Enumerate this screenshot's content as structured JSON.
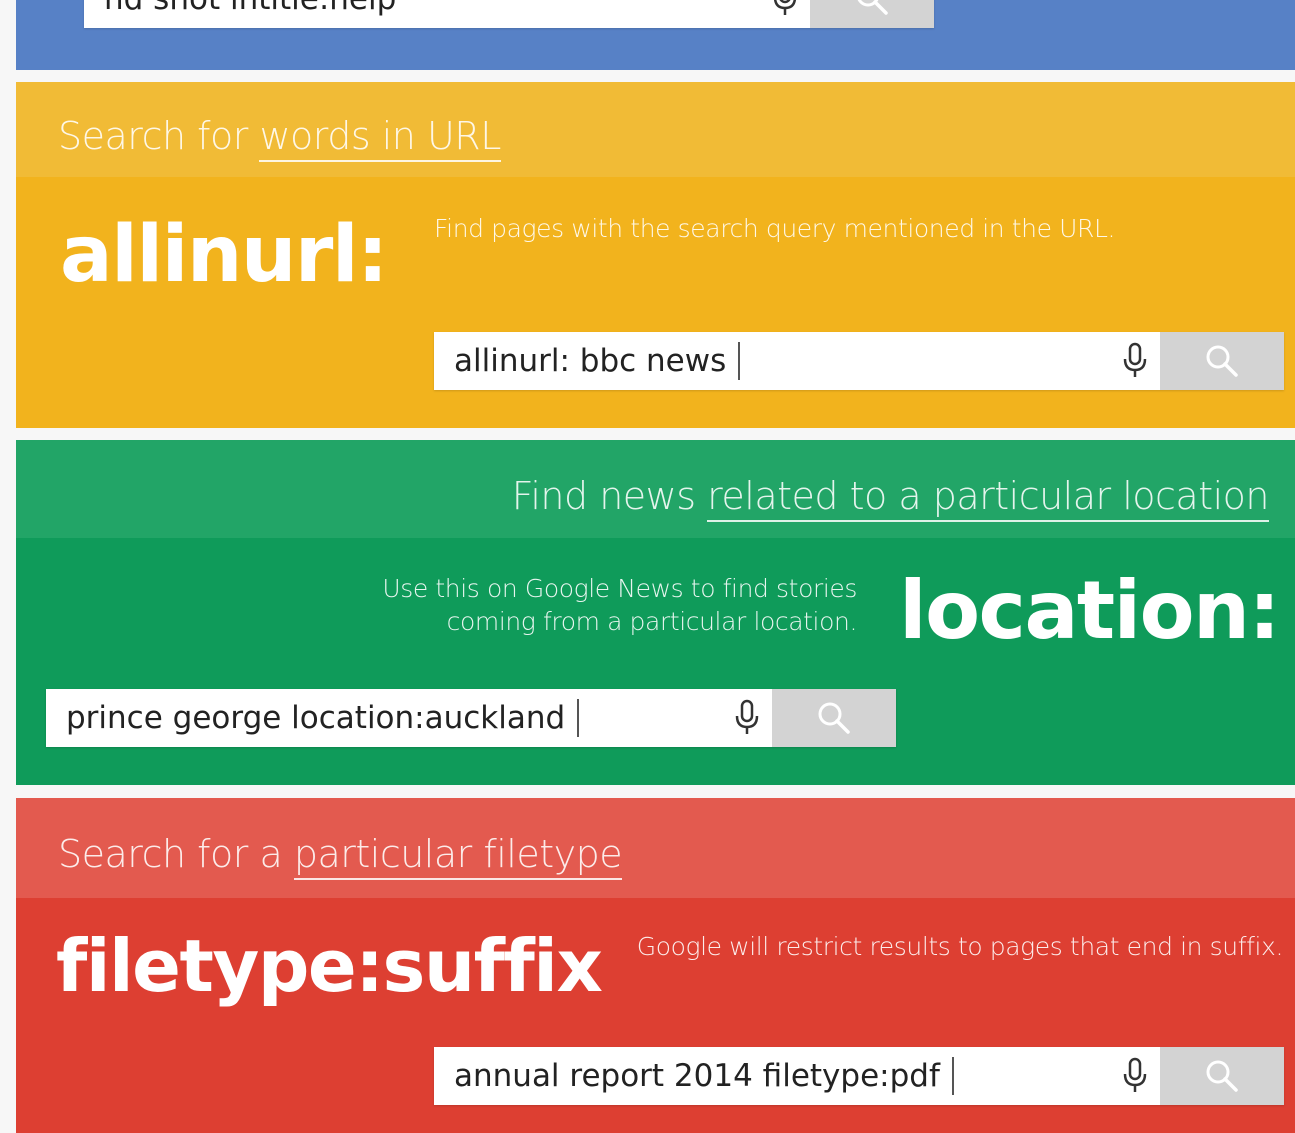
{
  "colors": {
    "blue": "#5781c6",
    "yellow": "#f2b31d",
    "yellow_band": "#f1bb36",
    "green": "#0f9b5a",
    "green_band": "#22a567",
    "red": "#dd3f32",
    "red_band": "#e35a4f",
    "search_button": "#d3d3d3"
  },
  "top_panel": {
    "search_text": "nd shot intitle:help"
  },
  "allinurl": {
    "heading_prefix": "Search for ",
    "heading_link": "words in URL",
    "operator": "allinurl:",
    "description": "Find pages with the search query mentioned in the URL.",
    "search_text": "allinurl: bbc news"
  },
  "location": {
    "heading_prefix": "Find news ",
    "heading_link": "related to a particular location",
    "operator": "location:",
    "description_line1": "Use this on Google News to find stories",
    "description_line2": "coming from a particular location.",
    "search_text": "prince george location:auckland"
  },
  "filetype": {
    "heading_prefix": "Search for a ",
    "heading_link": "particular filetype",
    "operator": "filetype:suffix",
    "description": "Google will restrict results to pages that end in suffix.",
    "search_text": "annual report 2014 filetype:pdf"
  },
  "icons": {
    "mic": "microphone-icon",
    "search": "magnifier-icon"
  }
}
